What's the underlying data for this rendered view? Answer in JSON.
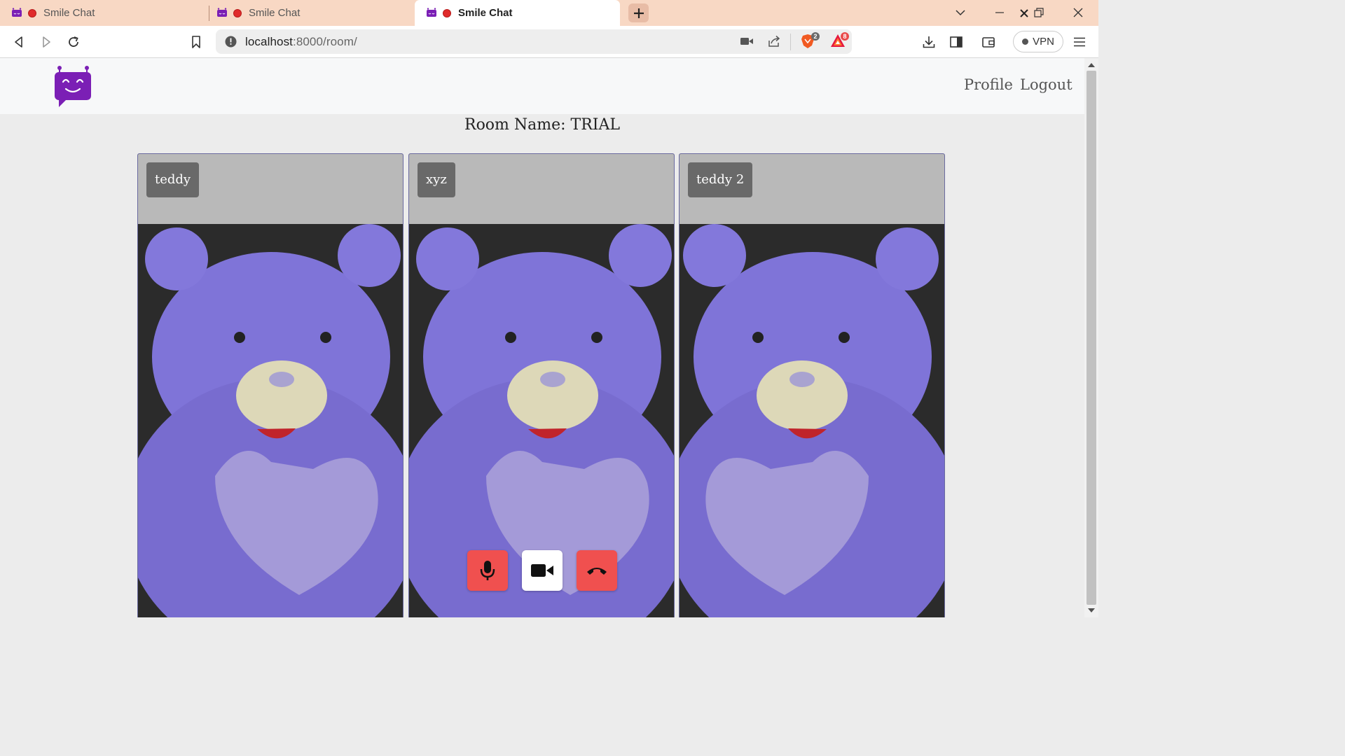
{
  "browser": {
    "tabs": [
      {
        "title": "Smile Chat",
        "active": false,
        "recording": true
      },
      {
        "title": "Smile Chat",
        "active": false,
        "recording": true
      },
      {
        "title": "Smile Chat",
        "active": true,
        "recording": true
      }
    ],
    "address": {
      "host": "localhost",
      "path": ":8000/room/"
    },
    "shields_count": "2",
    "rewards_count": "8",
    "vpn_label": "VPN"
  },
  "site": {
    "nav": {
      "profile": "Profile",
      "logout": "Logout"
    },
    "room_title": "Room Name: TRIAL"
  },
  "participants": [
    {
      "name": "teddy"
    },
    {
      "name": "xyz"
    },
    {
      "name": "teddy 2"
    }
  ],
  "controls": {
    "mic": {
      "icon": "microphone-icon",
      "color": "#f0504f"
    },
    "camera": {
      "icon": "video-camera-icon",
      "color": "#ffffff"
    },
    "leave": {
      "icon": "hang-up-phone-icon",
      "color": "#f0504f"
    }
  },
  "colors": {
    "brand_purple": "#7b1fb5",
    "tabbar_bg": "#f8d8c4",
    "control_red": "#f0504f"
  }
}
